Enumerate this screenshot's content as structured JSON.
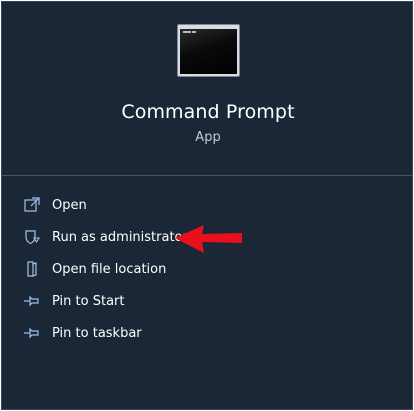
{
  "app": {
    "name": "Command Prompt",
    "type": "App",
    "icon": "command-prompt-icon"
  },
  "menu": {
    "items": [
      {
        "label": "Open",
        "icon": "open-icon"
      },
      {
        "label": "Run as administrator",
        "icon": "shield-icon"
      },
      {
        "label": "Open file location",
        "icon": "folder-icon"
      },
      {
        "label": "Pin to Start",
        "icon": "pin-icon"
      },
      {
        "label": "Pin to taskbar",
        "icon": "pin-icon"
      }
    ]
  },
  "colors": {
    "panel_bg": "#1b2737",
    "icon_accent": "#9fc3ea",
    "annotation_arrow": "#e8101a"
  }
}
